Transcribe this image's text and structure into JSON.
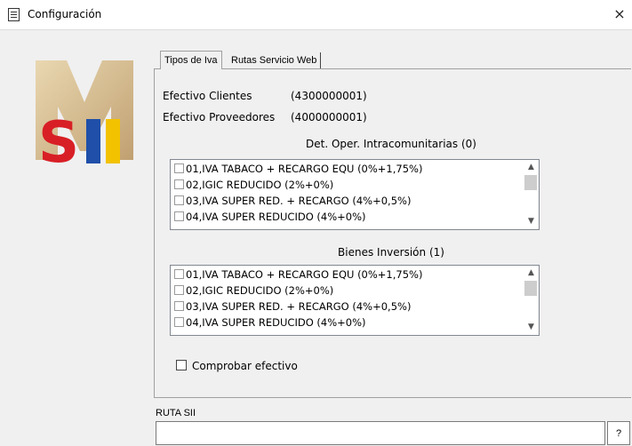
{
  "window": {
    "title": "Configuración",
    "close_icon": "×"
  },
  "logo": {
    "text": "SII",
    "colors": {
      "m": "#c9a86a",
      "s": "#d81f26",
      "i1": "#1f4fa8",
      "i2": "#f2c200"
    }
  },
  "tabs": [
    {
      "label": "Tipos de Iva",
      "active": true
    },
    {
      "label": "Rutas Servicio Web",
      "active": false
    }
  ],
  "efectivo_clientes": {
    "label": "Efectivo Clientes",
    "value": "(4300000001)"
  },
  "efectivo_proveedores": {
    "label": "Efectivo Proveedores",
    "value": "(4000000001)"
  },
  "intracomunitarias": {
    "title": "Det. Oper. Intracomunitarias (0)",
    "items": [
      "01,IVA TABACO + RECARGO EQU (0%+1,75%)",
      "02,IGIC REDUCIDO (2%+0%)",
      "03,IVA SUPER RED. + RECARGO (4%+0,5%)",
      "04,IVA SUPER REDUCIDO (4%+0%)"
    ]
  },
  "bienes_inversion": {
    "title": "Bienes Inversión (1)",
    "items": [
      "01,IVA TABACO + RECARGO EQU (0%+1,75%)",
      "02,IGIC REDUCIDO (2%+0%)",
      "03,IVA SUPER RED. + RECARGO (4%+0,5%)",
      "04,IVA SUPER REDUCIDO (4%+0%)"
    ]
  },
  "comprobar_efectivo": {
    "label": "Comprobar efectivo",
    "checked": false
  },
  "ruta_sii": {
    "label": "RUTA SII",
    "value": "",
    "button_label": "?"
  }
}
